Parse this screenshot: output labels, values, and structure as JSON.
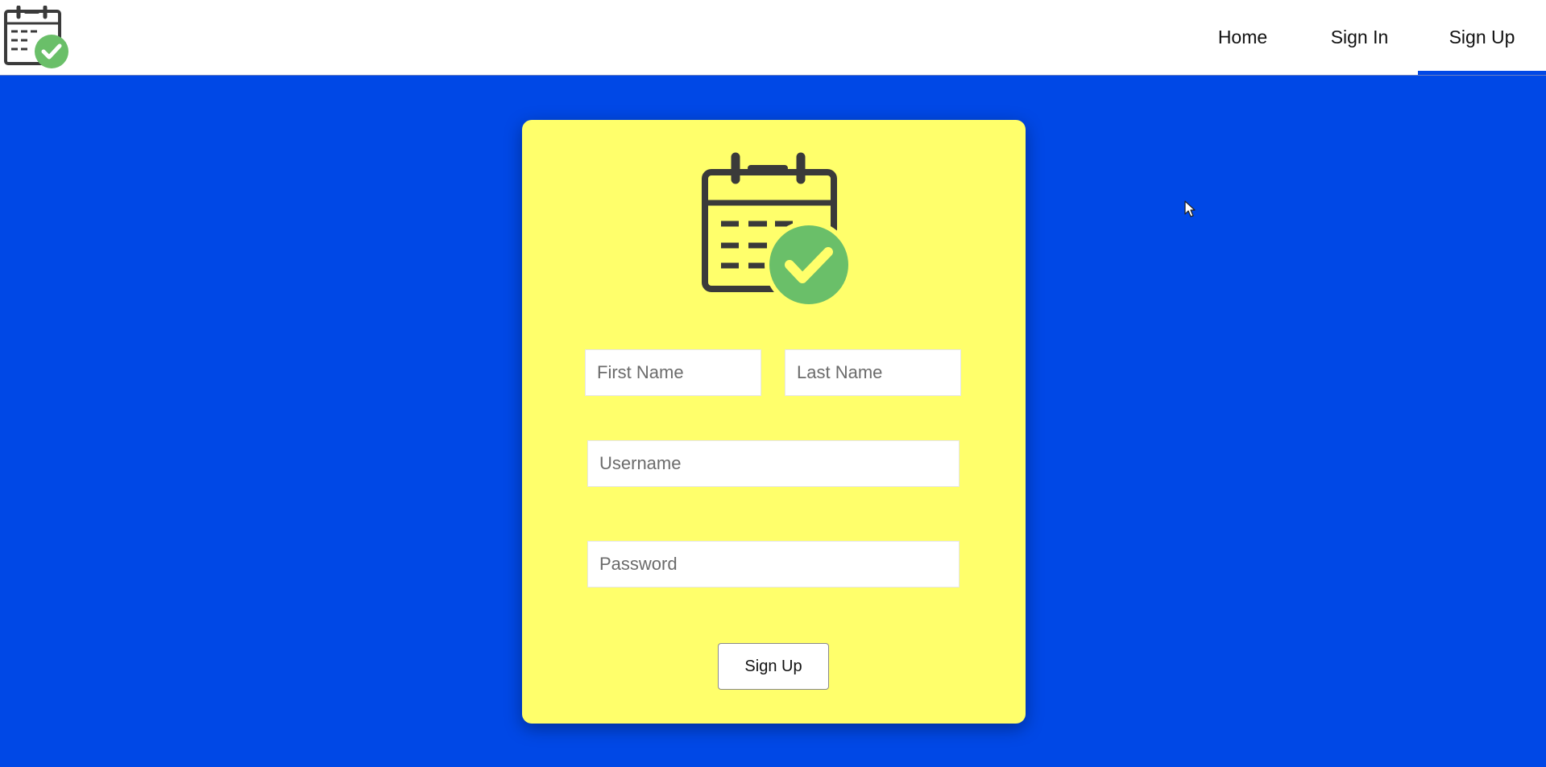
{
  "navbar": {
    "logo_icon": "calendar-check-icon",
    "links": [
      {
        "label": "Home",
        "active": false
      },
      {
        "label": "Sign In",
        "active": false
      },
      {
        "label": "Sign Up",
        "active": true
      }
    ]
  },
  "form": {
    "icon": "calendar-check-icon",
    "first_name": {
      "placeholder": "First Name",
      "value": ""
    },
    "last_name": {
      "placeholder": "Last Name",
      "value": ""
    },
    "username": {
      "placeholder": "Username",
      "value": ""
    },
    "password": {
      "placeholder": "Password",
      "value": ""
    },
    "submit_label": "Sign Up"
  },
  "colors": {
    "background": "#0048e6",
    "card": "#ffff6b",
    "check_green": "#6abf69",
    "icon_dark": "#3a3a3a"
  }
}
